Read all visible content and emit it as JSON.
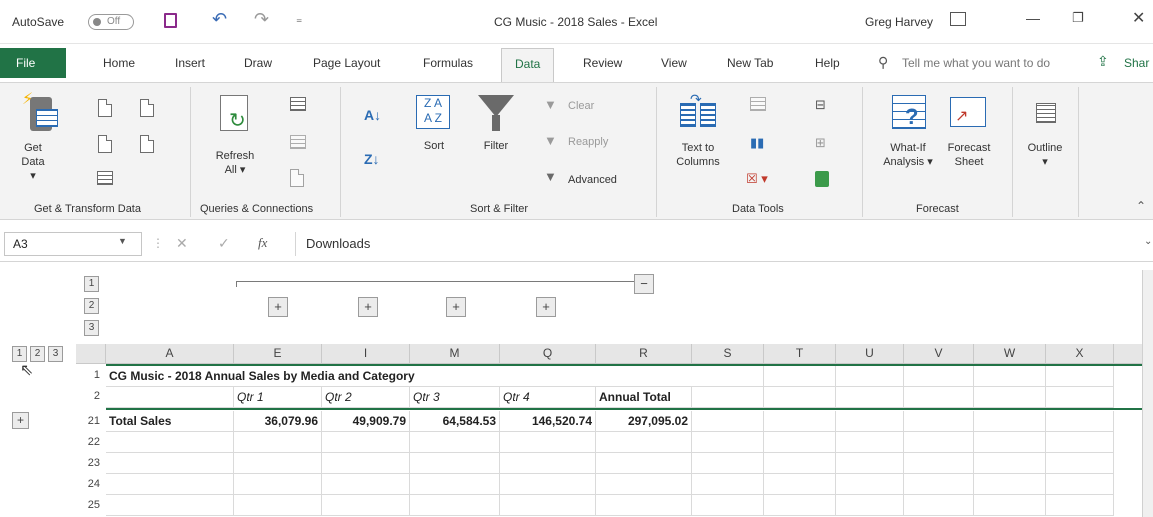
{
  "titlebar": {
    "autosave": "AutoSave",
    "autosave_state": "Off",
    "title": "CG Music - 2018 Sales  -  Excel",
    "user": "Greg Harvey"
  },
  "tabs": [
    "File",
    "Home",
    "Insert",
    "Draw",
    "Page Layout",
    "Formulas",
    "Data",
    "Review",
    "View",
    "New Tab",
    "Help"
  ],
  "tell_me": "Tell me what you want to do",
  "share": "Shar",
  "ribbon": {
    "get_data": "Get",
    "get_data2": "Data",
    "refresh": "Refresh",
    "refresh2": "All",
    "sort": "Sort",
    "filter": "Filter",
    "clear": "Clear",
    "reapply": "Reapply",
    "advanced": "Advanced",
    "text_to_columns": "Text to",
    "text_to_columns2": "Columns",
    "whatif": "What-If",
    "whatif2": "Analysis",
    "forecast_sheet": "Forecast",
    "forecast_sheet2": "Sheet",
    "outline": "Outline",
    "groups": {
      "get_transform": "Get & Transform Data",
      "queries": "Queries & Connections",
      "sort_filter": "Sort & Filter",
      "data_tools": "Data Tools",
      "forecast": "Forecast"
    }
  },
  "formula": {
    "namebox": "A3",
    "fx": "fx",
    "content": "Downloads"
  },
  "outline": {
    "row_levels": [
      "1",
      "2",
      "3"
    ],
    "col_levels": [
      "1",
      "2",
      "3"
    ]
  },
  "grid": {
    "columns": [
      "A",
      "E",
      "I",
      "M",
      "Q",
      "R",
      "S",
      "T",
      "U",
      "V",
      "W",
      "X"
    ],
    "rows": [
      {
        "num": "1",
        "cells": [
          "CG Music - 2018 Annual Sales by Media and Category",
          "",
          "",
          "",
          "",
          "",
          "",
          "",
          "",
          "",
          "",
          ""
        ]
      },
      {
        "num": "2",
        "cells": [
          "",
          "Qtr 1",
          "Qtr 2",
          "Qtr 3",
          "Qtr 4",
          "Annual Total",
          "",
          "",
          "",
          "",
          "",
          ""
        ]
      },
      {
        "num": "21",
        "cells": [
          "Total Sales",
          "36,079.96",
          "49,909.79",
          "64,584.53",
          "146,520.74",
          "297,095.02",
          "",
          "",
          "",
          "",
          "",
          ""
        ]
      },
      {
        "num": "22",
        "cells": [
          "",
          "",
          "",
          "",
          "",
          "",
          "",
          "",
          "",
          "",
          "",
          ""
        ]
      },
      {
        "num": "23",
        "cells": [
          "",
          "",
          "",
          "",
          "",
          "",
          "",
          "",
          "",
          "",
          "",
          ""
        ]
      },
      {
        "num": "24",
        "cells": [
          "",
          "",
          "",
          "",
          "",
          "",
          "",
          "",
          "",
          "",
          "",
          ""
        ]
      },
      {
        "num": "25",
        "cells": [
          "",
          "",
          "",
          "",
          "",
          "",
          "",
          "",
          "",
          "",
          "",
          ""
        ]
      }
    ]
  },
  "colors": {
    "excel_green": "#217346",
    "file_tab": "#217346"
  }
}
